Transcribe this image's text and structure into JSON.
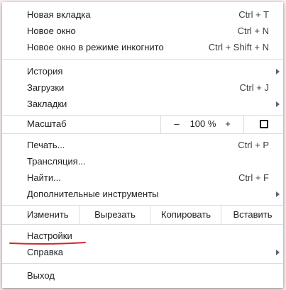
{
  "menu": {
    "new_tab": {
      "label": "Новая вкладка",
      "shortcut": "Ctrl + T"
    },
    "new_window": {
      "label": "Новое окно",
      "shortcut": "Ctrl + N"
    },
    "incognito": {
      "label": "Новое окно в режиме инкогнито",
      "shortcut": "Ctrl + Shift + N"
    },
    "history": {
      "label": "История"
    },
    "downloads": {
      "label": "Загрузки",
      "shortcut": "Ctrl + J"
    },
    "bookmarks": {
      "label": "Закладки"
    },
    "zoom": {
      "label": "Масштаб",
      "minus": "–",
      "value": "100 %",
      "plus": "+",
      "fullscreen_icon": "fullscreen-icon"
    },
    "print": {
      "label": "Печать...",
      "shortcut": "Ctrl + P"
    },
    "cast": {
      "label": "Трансляция..."
    },
    "find": {
      "label": "Найти...",
      "shortcut": "Ctrl + F"
    },
    "more_tools": {
      "label": "Дополнительные инструменты"
    },
    "edit": {
      "label": "Изменить",
      "cut": "Вырезать",
      "copy": "Копировать",
      "paste": "Вставить"
    },
    "settings": {
      "label": "Настройки"
    },
    "help": {
      "label": "Справка"
    },
    "exit": {
      "label": "Выход"
    }
  },
  "colors": {
    "highlight_underline": "#d0282e",
    "separator": "#dadce0",
    "text": "#202124"
  }
}
